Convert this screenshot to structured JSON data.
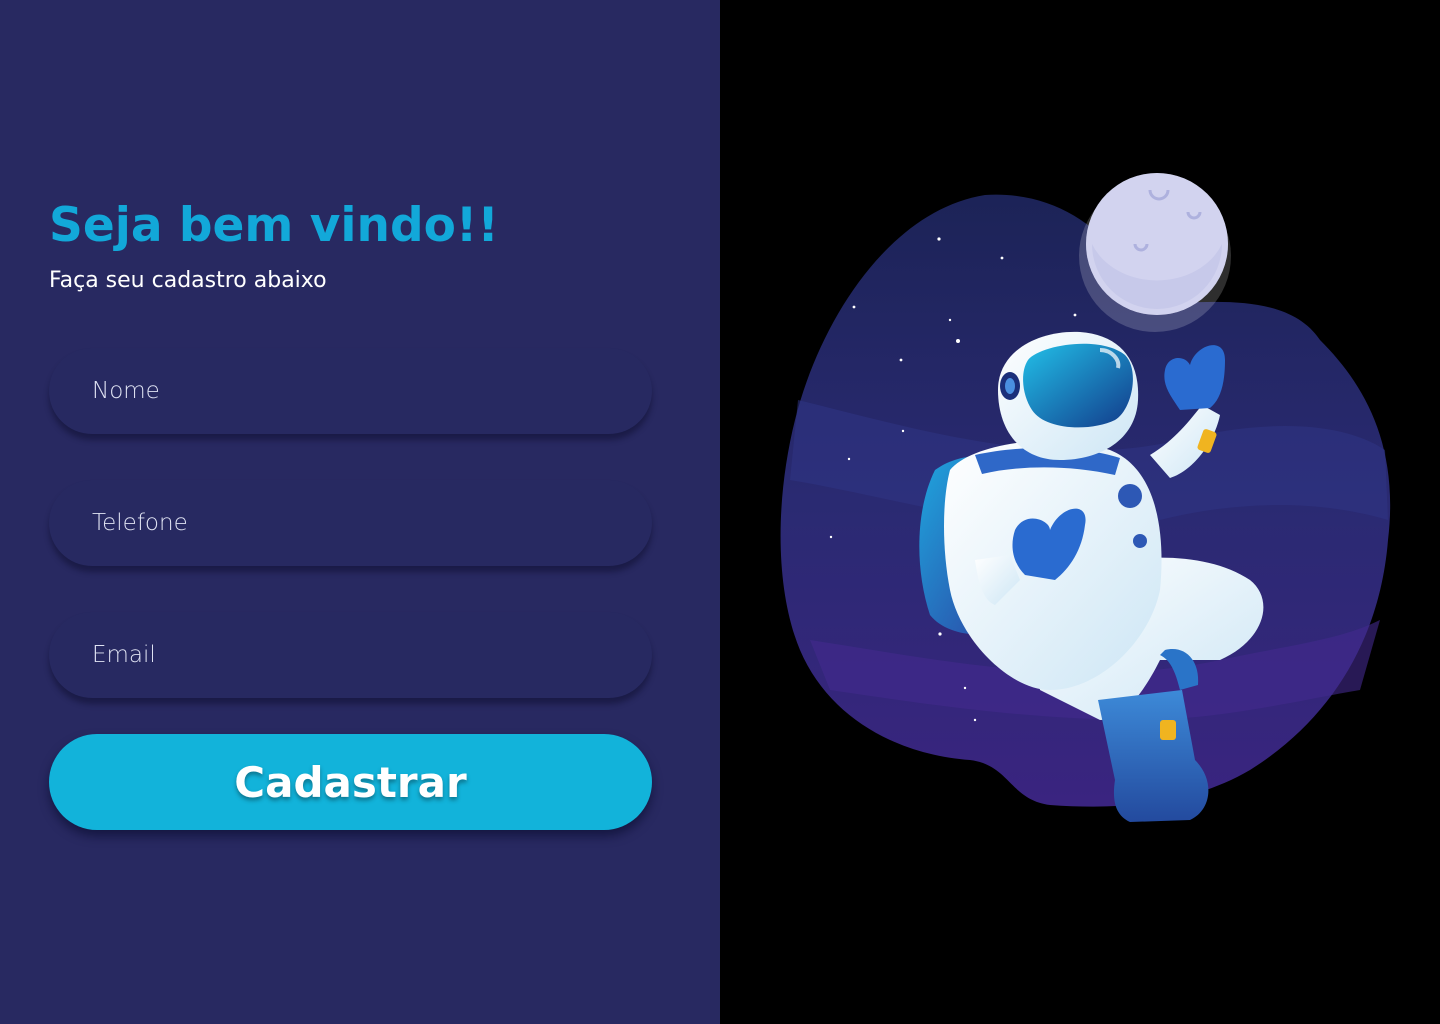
{
  "signup": {
    "title": "Seja bem vindo!!",
    "subtitle": "Faça seu cadastro abaixo",
    "fields": {
      "name_placeholder": "Nome",
      "phone_placeholder": "Telefone",
      "email_placeholder": "Email"
    },
    "submit_label": "Cadastrar"
  },
  "colors": {
    "panel_background": "#282961",
    "accent": "#12b3da",
    "title": "#12a8d9",
    "right_background": "#000000"
  },
  "illustration": {
    "icon": "astronaut-moon-illustration"
  }
}
